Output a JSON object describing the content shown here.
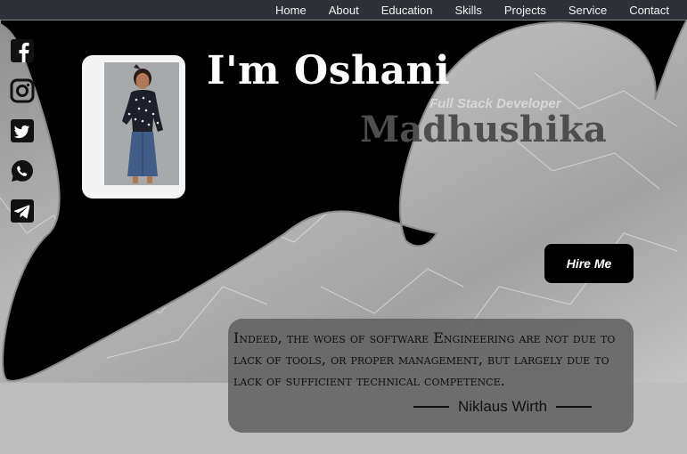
{
  "nav": {
    "items": [
      "Home",
      "About",
      "Education",
      "Skills",
      "Projects",
      "Service",
      "Contact"
    ]
  },
  "social": {
    "icons": [
      "facebook-icon",
      "instagram-icon",
      "twitter-icon",
      "whatsapp-icon",
      "telegram-icon"
    ]
  },
  "hero": {
    "name_first": "I'm Oshani",
    "role": "Full Stack Developer",
    "name_last": "Madhushika",
    "hire_label": "Hire Me"
  },
  "quote": {
    "text": "Indeed, the woes of software Engineering are not due to lack of tools, or proper management, but largely due to lack of sufficient technical competence.",
    "author": "Niklaus Wirth"
  },
  "colors": {
    "navbar": "#2e3238",
    "hero_dark": "#000000",
    "quote_box": "#5f5f5f",
    "page_bg": "#bdbdbd"
  }
}
